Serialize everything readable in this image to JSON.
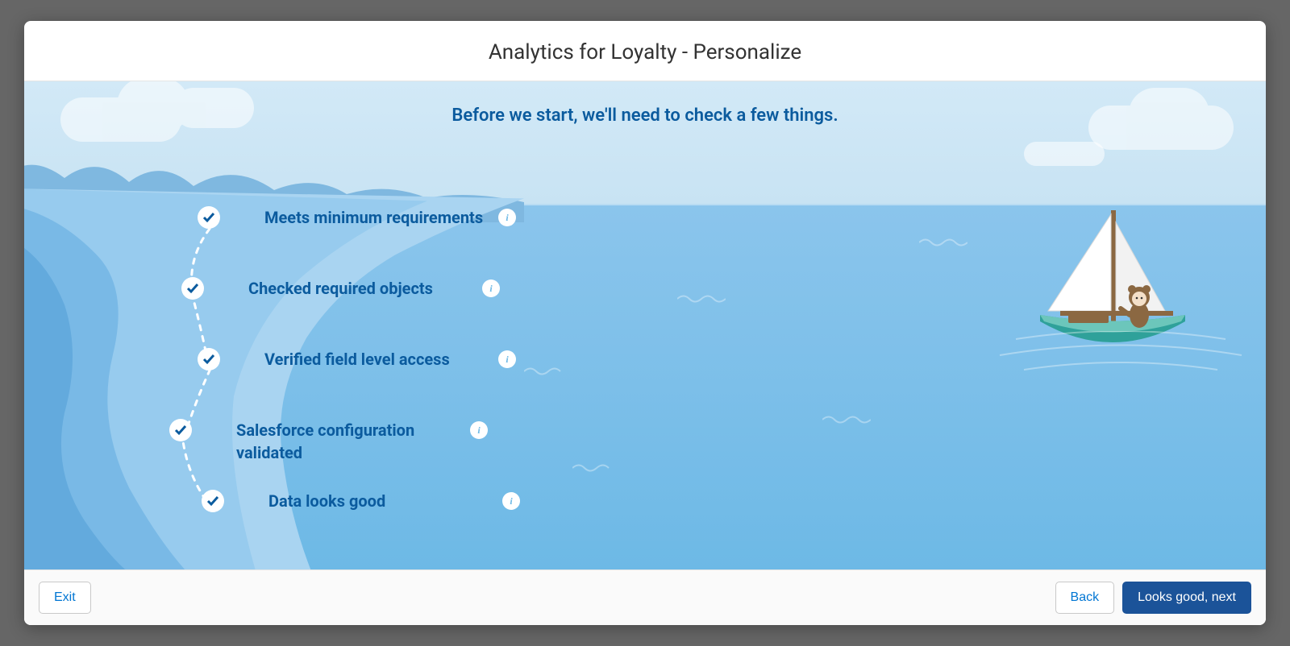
{
  "header": {
    "title": "Analytics for Loyalty - Personalize"
  },
  "intro": {
    "message": "Before we start, we'll need to check a few things."
  },
  "checklist": [
    {
      "label": "Meets minimum requirements",
      "status": "checked"
    },
    {
      "label": "Checked required objects",
      "status": "checked"
    },
    {
      "label": "Verified field level access",
      "status": "checked"
    },
    {
      "label": "Salesforce configuration validated",
      "status": "checked"
    },
    {
      "label": "Data looks good",
      "status": "checked"
    }
  ],
  "footer": {
    "exit_label": "Exit",
    "back_label": "Back",
    "next_label": "Looks good, next"
  }
}
